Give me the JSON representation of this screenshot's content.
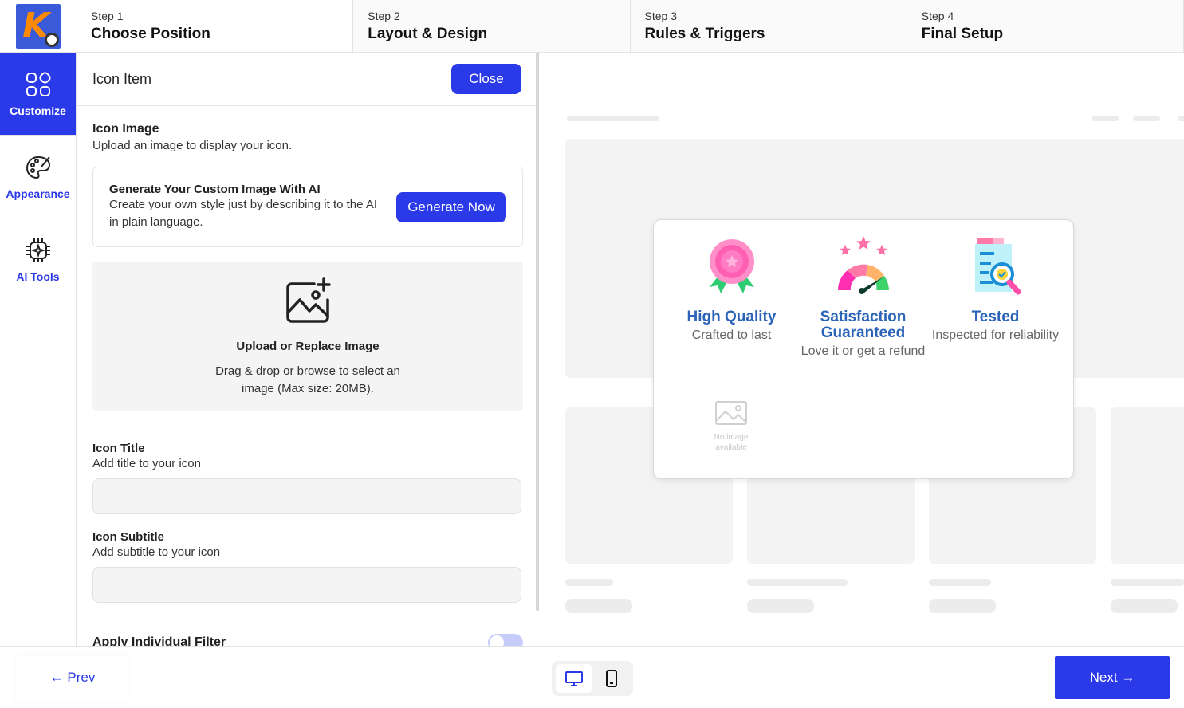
{
  "steps": [
    {
      "num": "Step 1",
      "title": "Choose Position"
    },
    {
      "num": "Step 2",
      "title": "Layout & Design"
    },
    {
      "num": "Step 3",
      "title": "Rules & Triggers"
    },
    {
      "num": "Step 4",
      "title": "Final Setup"
    }
  ],
  "sidenav": {
    "items": [
      {
        "label": "Customize",
        "icon": "grid-icon",
        "active": true
      },
      {
        "label": "Appearance",
        "icon": "palette-icon",
        "active": false
      },
      {
        "label": "AI Tools",
        "icon": "chip-icon",
        "active": false
      }
    ]
  },
  "panel": {
    "title": "Icon Item",
    "close_label": "Close",
    "icon_image": {
      "title": "Icon Image",
      "subtitle": "Upload an image to display your icon."
    },
    "ai": {
      "title": "Generate Your Custom Image With AI",
      "desc": "Create your own style just by describing it to the AI in plain language.",
      "button": "Generate Now"
    },
    "upload": {
      "title": "Upload or Replace Image",
      "desc": "Drag & drop or browse to select an image (Max size: 20MB)."
    },
    "icon_title": {
      "title": "Icon Title",
      "subtitle": "Add title to your icon",
      "value": ""
    },
    "icon_subtitle": {
      "title": "Icon Subtitle",
      "subtitle": "Add subtitle to your icon",
      "value": ""
    },
    "filter": {
      "title": "Apply Individual Filter"
    }
  },
  "preview": {
    "items": [
      {
        "title": "High Quality",
        "subtitle": "Crafted to last",
        "icon": "award-rosette-icon"
      },
      {
        "title": "Satisfaction Guaranteed",
        "subtitle": "Love it or get a refund",
        "icon": "satisfaction-gauge-icon"
      },
      {
        "title": "Tested",
        "subtitle": "Inspected for reliability",
        "icon": "inspection-clipboard-icon"
      }
    ],
    "placeholder": "No image available"
  },
  "footer": {
    "prev_label": "← Prev",
    "next_label": "Next →"
  },
  "colors": {
    "accent": "#2b3ae8",
    "title_blue": "#2a63b8"
  }
}
